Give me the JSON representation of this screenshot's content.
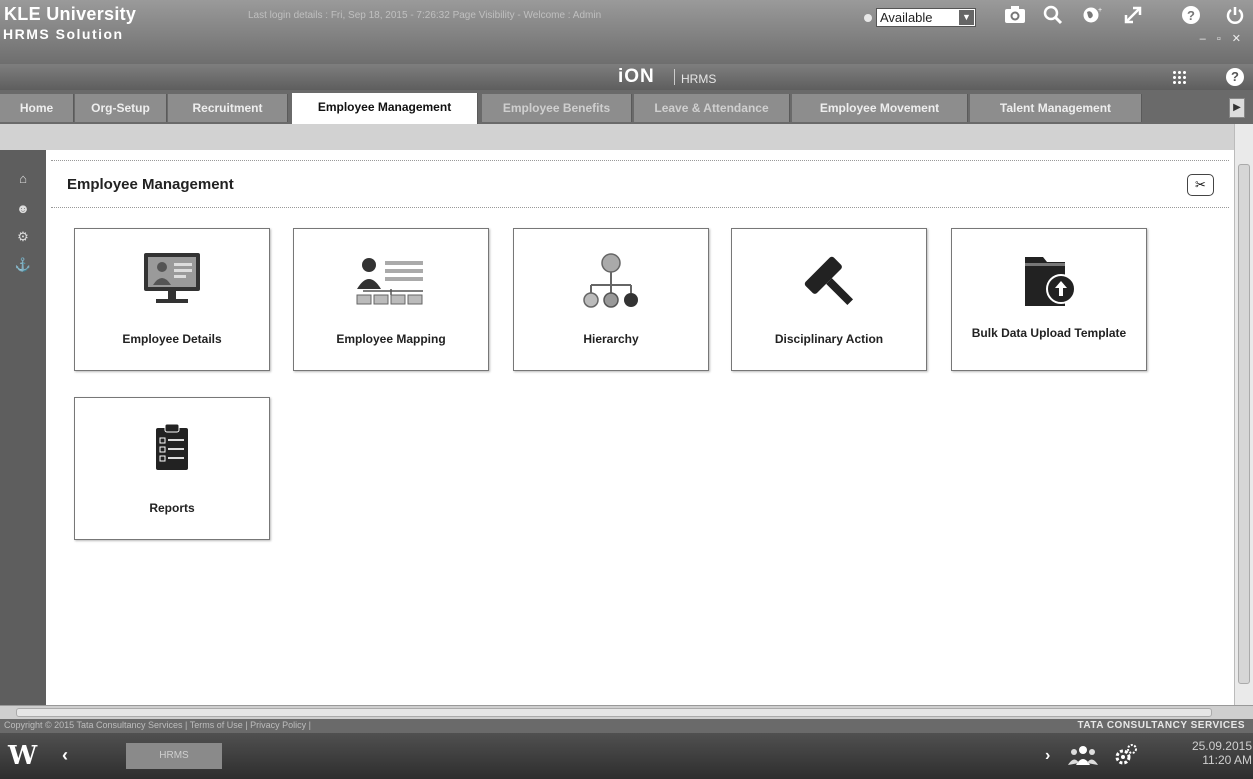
{
  "header": {
    "app_title": "KLE University",
    "app_subtitle": "HRMS Solution",
    "last_login": "Last login details : Fri, Sep 18, 2015 - 7:26:32 Page Visibility - Welcome : Admin",
    "status": {
      "selected": "Available"
    },
    "icons": [
      "camera-icon",
      "search-icon",
      "globe-icon",
      "expand-icon",
      "help-icon",
      "power-icon"
    ]
  },
  "brand_bar": {
    "brand": "iON",
    "product": "HRMS"
  },
  "tabs": [
    {
      "label": "Home"
    },
    {
      "label": "Org-Setup"
    },
    {
      "label": "Recruitment"
    },
    {
      "label": "Employee Management",
      "active": true
    },
    {
      "label": "Employee Benefits"
    },
    {
      "label": "Leave & Attendance"
    },
    {
      "label": "Employee Movement"
    },
    {
      "label": "Talent Management"
    }
  ],
  "section": {
    "title": "Employee Management"
  },
  "tiles": [
    {
      "label": "Employee Details",
      "icon": "monitor-user-icon"
    },
    {
      "label": "Employee Mapping",
      "icon": "user-mapping-icon"
    },
    {
      "label": "Hierarchy",
      "icon": "hierarchy-icon"
    },
    {
      "label": "Disciplinary Action",
      "icon": "gavel-icon"
    },
    {
      "label": "Bulk Data Upload Template",
      "icon": "upload-folder-icon"
    },
    {
      "label": "Reports",
      "icon": "clipboard-report-icon"
    }
  ],
  "footer": {
    "copyright": "Copyright © 2015 Tata Consultancy Services | Terms of Use | Privacy Policy |",
    "company": "TATA CONSULTANCY SERVICES"
  },
  "taskbar": {
    "item": "HRMS",
    "date": "25.09.2015",
    "time": "11:20 AM"
  },
  "colors": {
    "header_bg": "#7a7a7a",
    "active_tab_bg": "#ffffff",
    "tab_bg": "#8d8d8d",
    "rail_bg": "#5e5e5e"
  }
}
